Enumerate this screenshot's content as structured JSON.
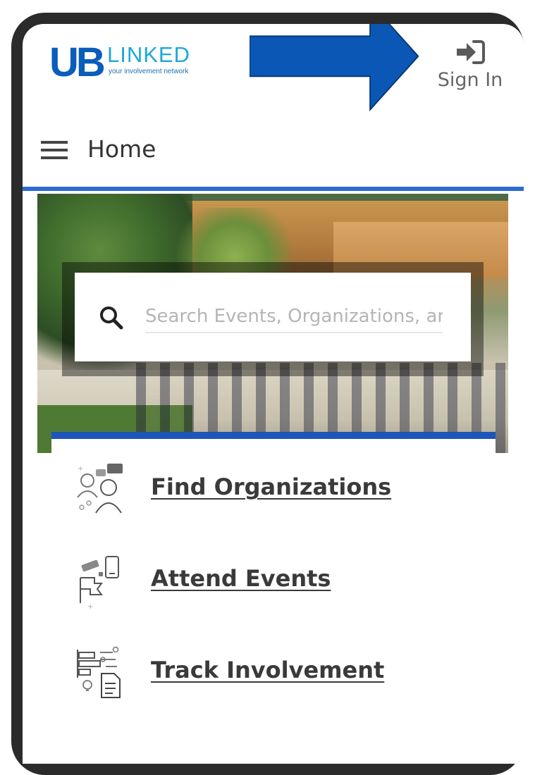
{
  "header": {
    "logo": {
      "ub": "UB",
      "linked": "LINKED",
      "tagline": "your involvement network"
    },
    "sign_in": {
      "label": "Sign In",
      "icon": "sign-in-icon"
    }
  },
  "nav": {
    "menu_icon": "hamburger-menu-icon",
    "title": "Home"
  },
  "hero": {
    "search": {
      "placeholder": "Search Events, Organizations, an",
      "icon": "search-icon"
    }
  },
  "links": [
    {
      "label": "Find Organizations",
      "icon": "find-organizations-icon"
    },
    {
      "label": "Attend Events",
      "icon": "attend-events-icon"
    },
    {
      "label": "Track Involvement",
      "icon": "track-involvement-icon"
    }
  ],
  "colors": {
    "brand_blue": "#0a5dbb",
    "brand_light_blue": "#1fa7d8",
    "accent_bar": "#2e6bd1",
    "annotation_arrow": "#0b57b6",
    "text_dark": "#3a3a3a",
    "text_muted": "#666666"
  }
}
